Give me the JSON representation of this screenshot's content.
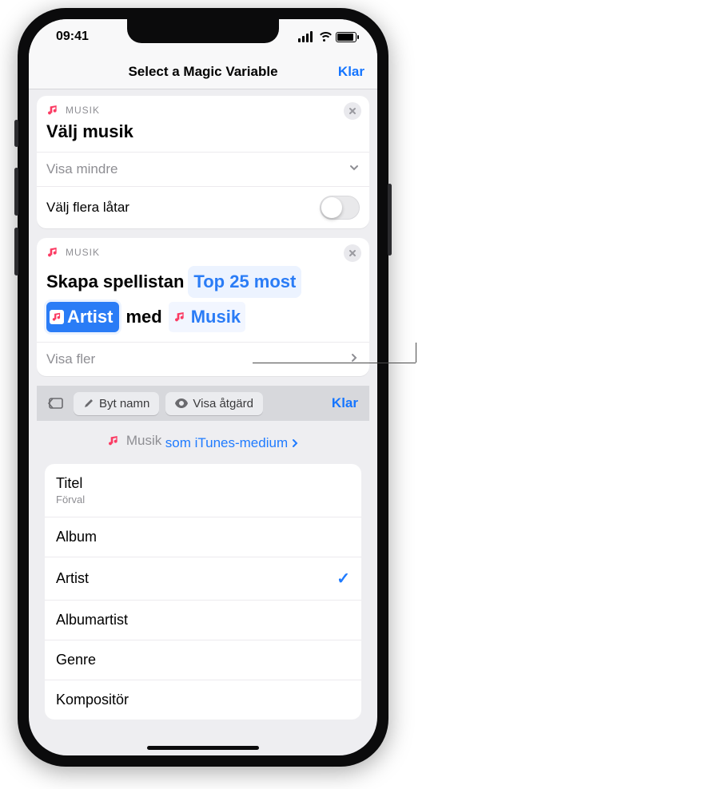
{
  "status": {
    "time": "09:41"
  },
  "nav": {
    "title": "Select a Magic Variable",
    "done": "Klar"
  },
  "card1": {
    "category": "MUSIK",
    "title": "Välj musik",
    "row_less": "Visa mindre",
    "row_multi": "Välj flera låtar"
  },
  "card2": {
    "category": "MUSIK",
    "t1": "Skapa spellistan",
    "t2": "Top 25 most",
    "t3": "Artist",
    "t4": "med",
    "t5": "Musik",
    "row_more": "Visa fler"
  },
  "toolbar": {
    "rename": "Byt namn",
    "reveal": "Visa åtgärd",
    "done": "Klar"
  },
  "varinfo": {
    "name": "Musik",
    "as": "som iTunes-medium"
  },
  "props": {
    "title": "Titel",
    "title_sub": "Förval",
    "album": "Album",
    "artist": "Artist",
    "albumartist": "Albumartist",
    "genre": "Genre",
    "composer": "Kompositör"
  }
}
